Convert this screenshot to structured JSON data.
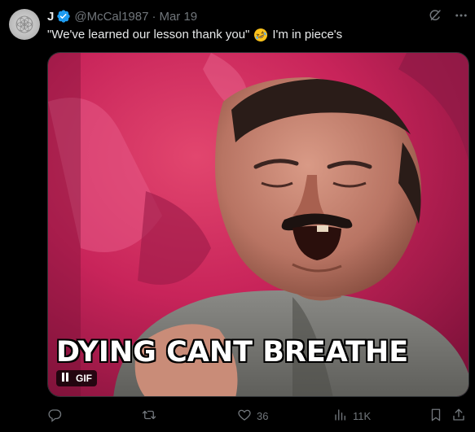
{
  "author": {
    "display_name": "J",
    "handle": "@McCal1987",
    "separator": "·",
    "timestamp": "Mar 19",
    "verified": true
  },
  "tweet": {
    "text_before_emoji": "\"We've learned our lesson thank you\"",
    "emoji": "rolling-on-floor-laughing-emoji",
    "text_after_emoji": "I'm in piece's"
  },
  "media": {
    "type": "gif",
    "caption": "DYING CANT BREATHE",
    "gif_label": "GIF",
    "state": "pause-icon"
  },
  "actions": {
    "reply_count": "",
    "repost_count": "",
    "like_count": "36",
    "view_count": "11K"
  },
  "icons": {
    "top": [
      "grok-icon",
      "more-icon"
    ],
    "bar": [
      "reply-icon",
      "repost-icon",
      "like-icon",
      "views-icon",
      "bookmark-icon",
      "share-icon"
    ]
  },
  "colors": {
    "background": "#000000",
    "text_primary": "#e7e9ea",
    "text_secondary": "#71767b",
    "verified_blue": "#1d9bf0"
  }
}
